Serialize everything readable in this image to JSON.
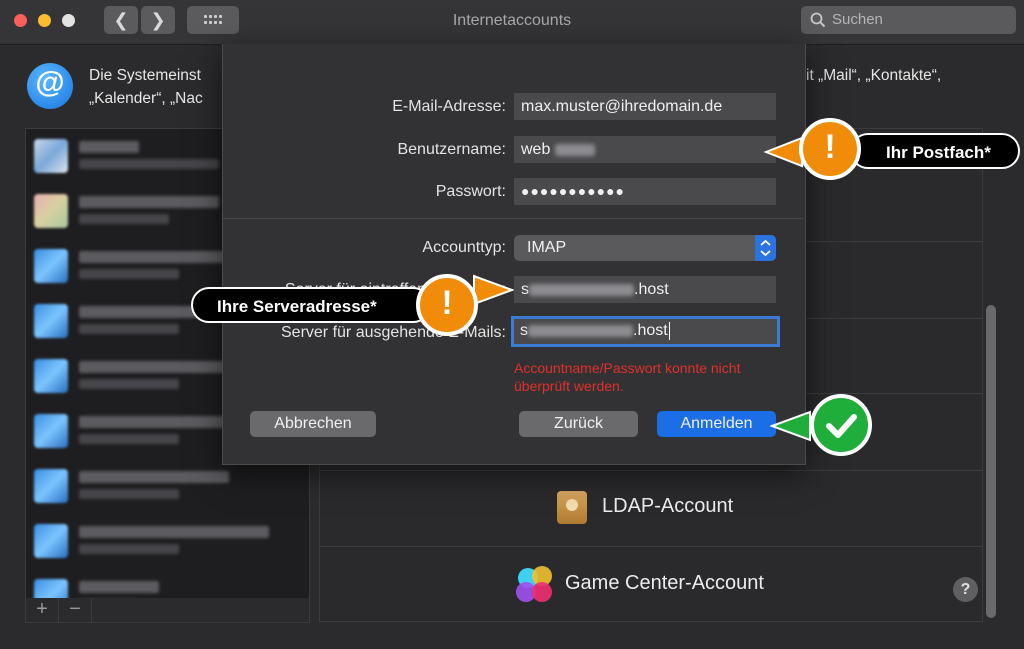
{
  "window": {
    "title": "Internetaccounts"
  },
  "toolbar": {
    "back": "❮",
    "forward": "❯",
    "search_placeholder": "Suchen"
  },
  "header": {
    "description_line1_left": "Die Systemeinst",
    "description_line1_right": "it „Mail“, „Kontakte“,",
    "description_line2_left": "„Kalender“, „Nac"
  },
  "left_panel": {
    "add": "+",
    "remove": "−"
  },
  "providers": [
    {
      "label": "LDAP-Account"
    },
    {
      "label": "Game Center-Account"
    }
  ],
  "help": "?",
  "dialog": {
    "email_label": "E-Mail-Adresse:",
    "email_value": "max.muster@ihredomain.de",
    "username_label": "Benutzername:",
    "username_value": "web",
    "password_label": "Passwort:",
    "password_value": "●●●●●●●●●●●",
    "account_type_label": "Accounttyp:",
    "account_type_value": "IMAP",
    "incoming_server_label": "Server für eintreffende E-Mails:",
    "incoming_server_prefix": "s",
    "incoming_server_suffix": ".host",
    "outgoing_server_label": "Server für ausgehende E-Mails:",
    "outgoing_server_prefix": "s",
    "outgoing_server_suffix": ".host",
    "error_line1": "Accountname/Passwort konnte nicht",
    "error_line2": "überprüft werden.",
    "cancel": "Abbrechen",
    "back": "Zurück",
    "sign_in": "Anmelden"
  },
  "callouts": {
    "mailbox": "Ihr Postfach*",
    "server": "Ihre Serveradresse*",
    "warn_symbol": "!"
  },
  "colors": {
    "accent": "#1c6ee6",
    "warning": "#f08c0a",
    "success": "#1fae3a",
    "error": "#e0302a"
  }
}
